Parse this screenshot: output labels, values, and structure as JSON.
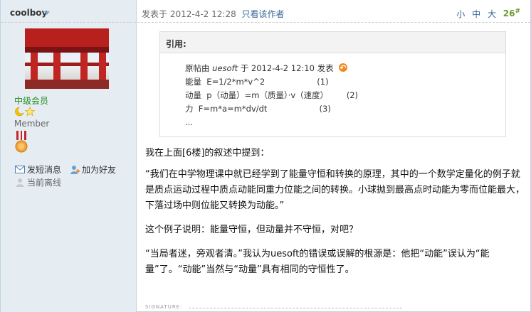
{
  "author": {
    "username": "coolboy",
    "grade": "中级会员",
    "member_label": "Member",
    "actions": {
      "send_pm": "发短消息",
      "add_friend": "加为好友",
      "status": "当前离线"
    }
  },
  "post": {
    "posted_prefix": "发表于",
    "posted_time": "2012-4-2 12:28",
    "only_author": "只看该作者",
    "font_small": "小",
    "font_medium": "中",
    "font_large": "大",
    "floor_number": "26",
    "floor_suffix": "#"
  },
  "quote": {
    "header": "引用:",
    "original_prefix": "原帖由",
    "original_author": "uesoft",
    "original_mid": "于",
    "original_time": "2012-4-2 12:10",
    "original_suffix": "发表",
    "lines": [
      "能量  E=1/2*m*v^2                    (1)",
      "动量  p（动量）=m（质量）·v（速度）       (2)",
      "力  F=m*a=m*dv/dt                    (3)",
      "..."
    ]
  },
  "content": {
    "paragraphs": [
      "我在上面[6楼]的叙述中提到：",
      "“我们在中学物理课中就已经学到了能量守恒和转换的原理，其中的一个数学定量化的例子就是质点运动过程中质点动能同重力位能之间的转换。小球抛到最高点时动能为零而位能最大，下落过场中则位能又转换为动能。”",
      "这个例子说明：能量守恒，但动量并不守恒，对吧？",
      "“当局者迷，旁观者清。”我认为uesoft的错误或误解的根源是：他把“动能”误认为“能量”了。“动能”当然与“动量”具有相同的守恒性了。"
    ],
    "signature_label": "SIGNATURE:"
  },
  "colors": {
    "sidebar_bg": "#e5edf2",
    "link": "#336699",
    "grade_green": "#228b22",
    "floor_green": "#6c9b2f",
    "accent_orange": "#f08a24"
  }
}
